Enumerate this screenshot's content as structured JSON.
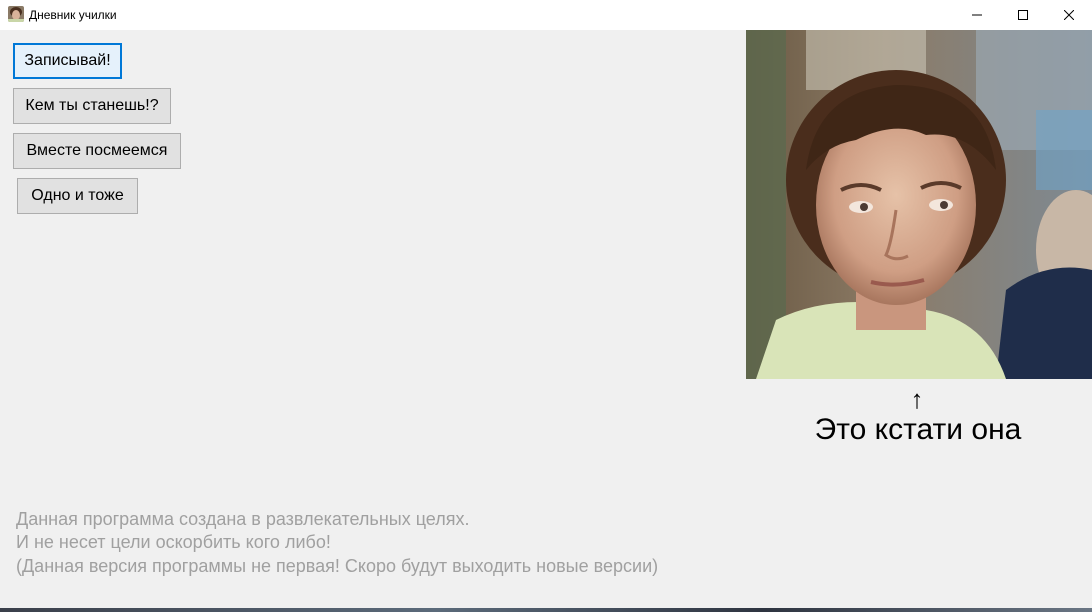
{
  "window": {
    "title": "Дневник училки",
    "controls": {
      "minimize_icon": "minimize-icon",
      "maximize_icon": "maximize-icon",
      "close_icon": "close-icon"
    }
  },
  "buttons": [
    {
      "label": "Записывай!",
      "focused": true
    },
    {
      "label": "Кем ты станешь!?",
      "focused": false
    },
    {
      "label": "Вместе посмеемся",
      "focused": false
    },
    {
      "label": "Одно и тоже",
      "focused": false
    }
  ],
  "photo": {
    "arrow": "↑",
    "caption": "Это кстати она"
  },
  "disclaimer": {
    "line1": "Данная программа создана в развлекательных целях.",
    "line2": "И не несет цели оскорбить кого либо!",
    "line3": "(Данная версия программы не первая! Скоро будут выходить новые версии)"
  },
  "colors": {
    "background": "#f0f0f0",
    "titlebar": "#ffffff",
    "button_bg": "#e1e1e1",
    "button_border": "#adadad",
    "focus_border": "#0078d7",
    "disclaimer_text": "#a0a0a0"
  }
}
